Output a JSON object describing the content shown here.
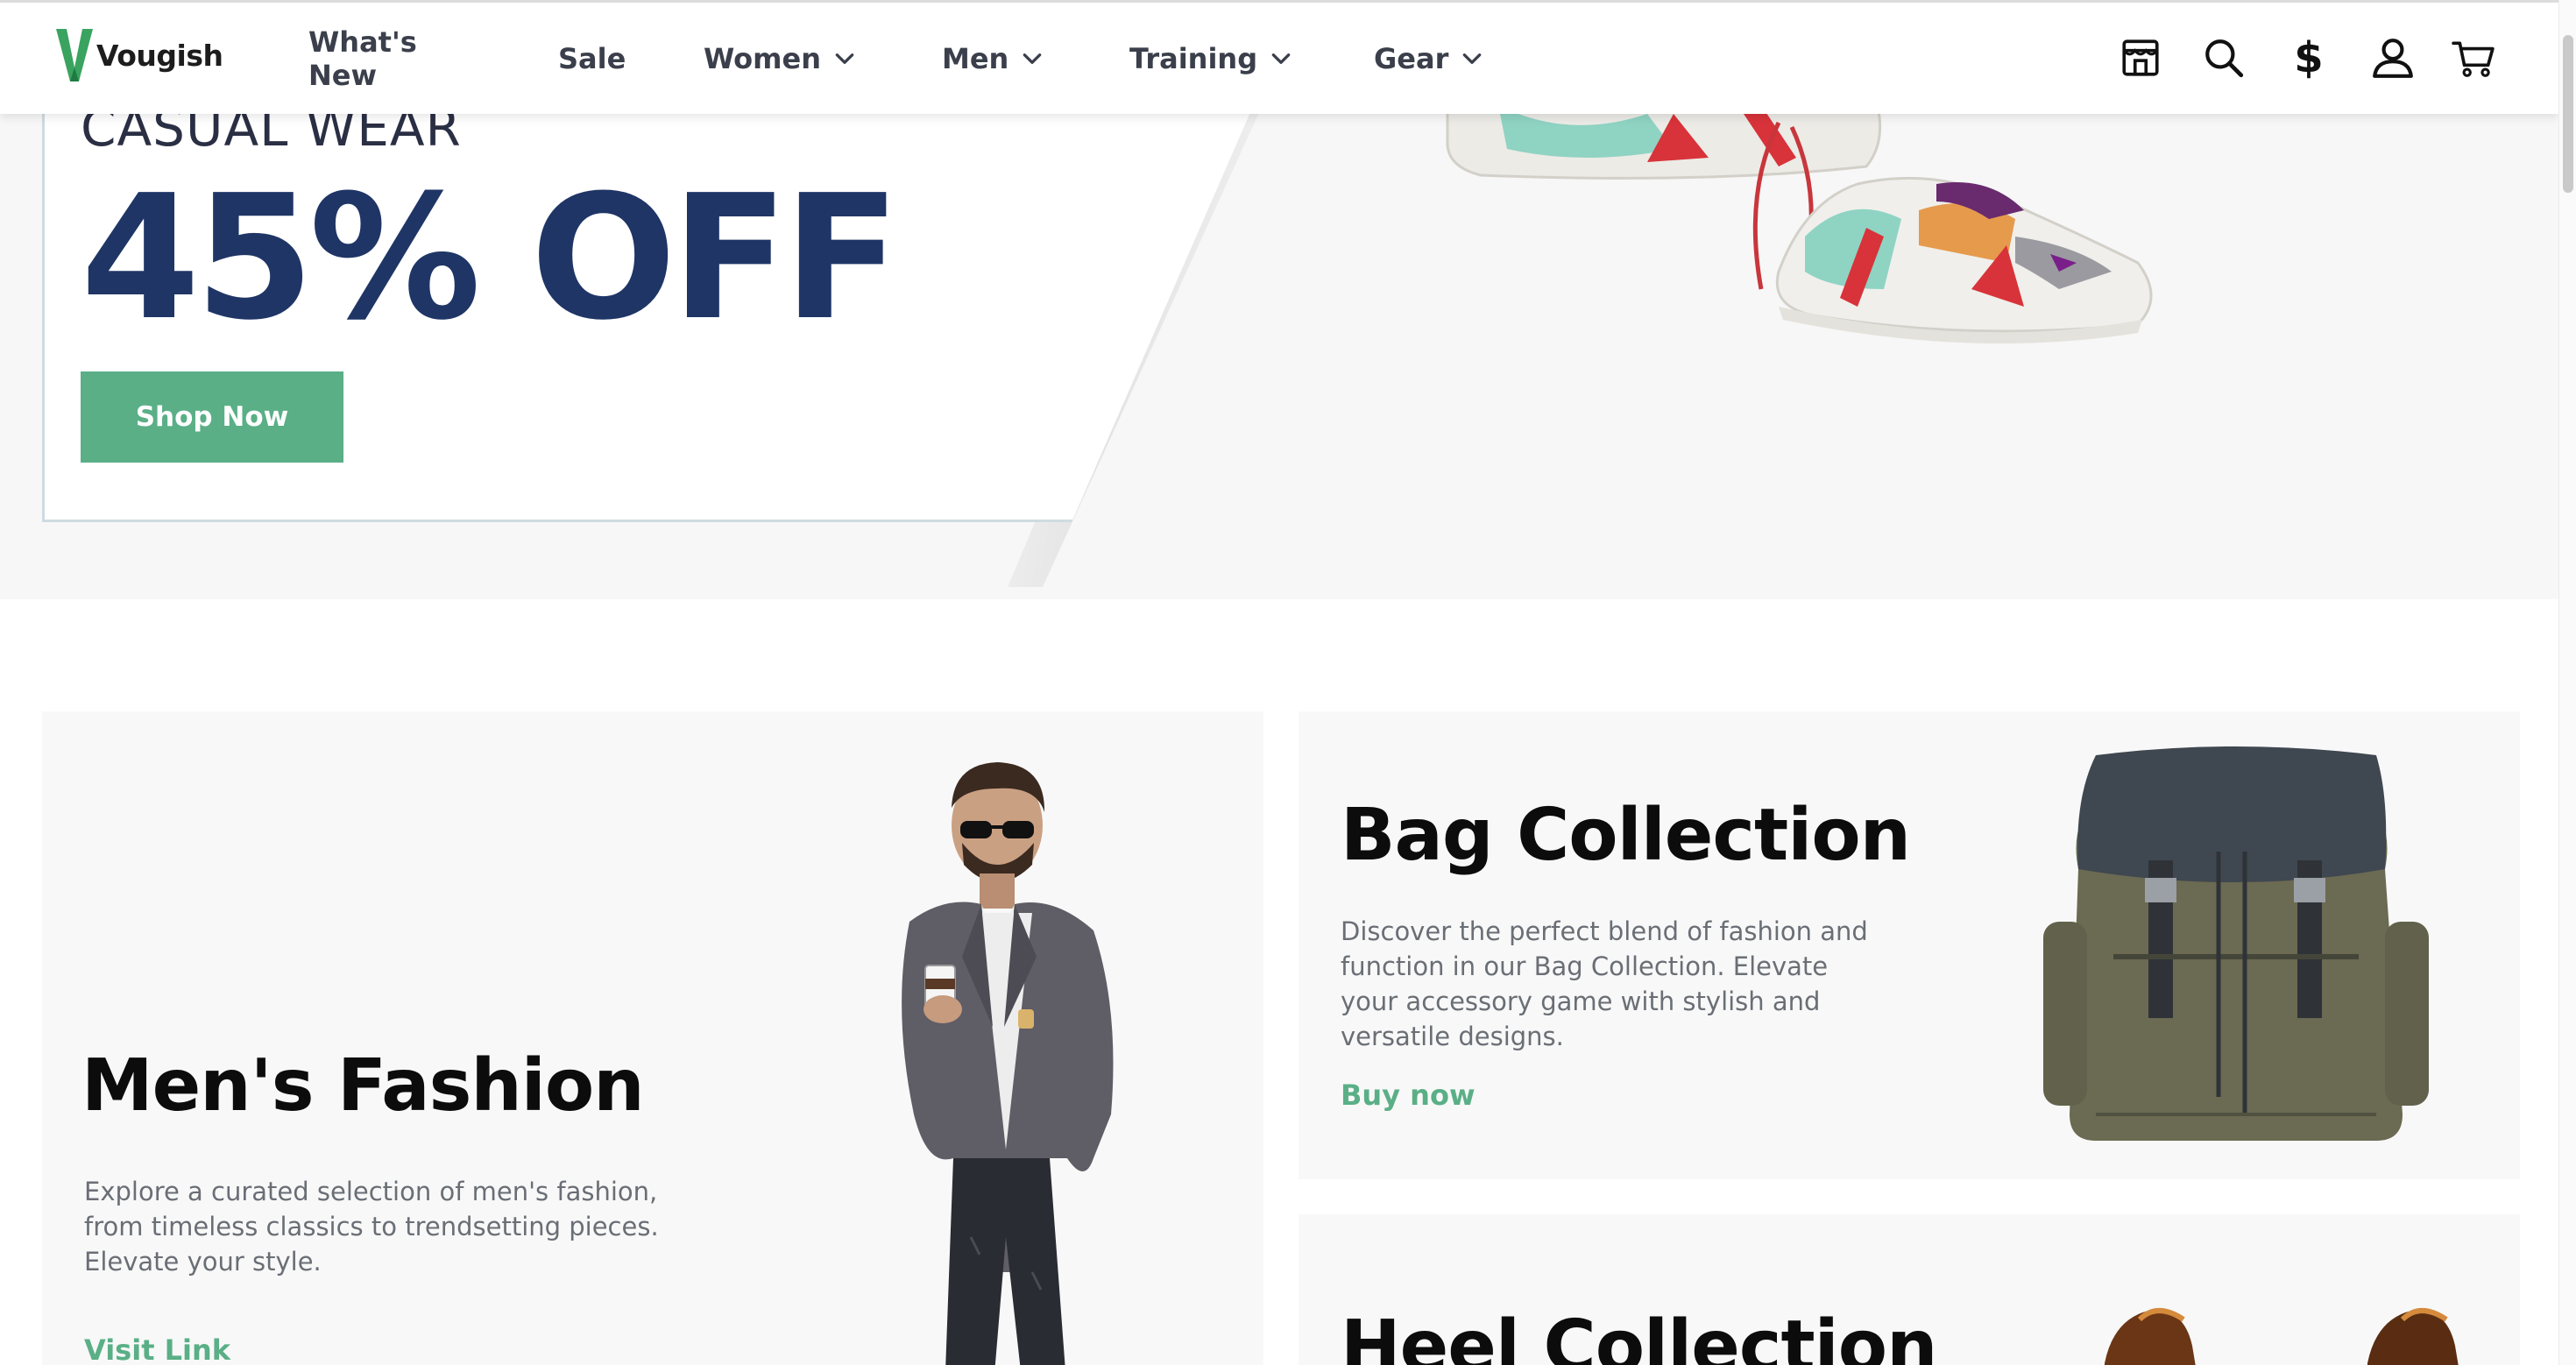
{
  "brand": {
    "name": "Vougish",
    "logo_color": "#3aa35f"
  },
  "nav": {
    "items": [
      {
        "label": "What's New",
        "has_dropdown": false
      },
      {
        "label": "Sale",
        "has_dropdown": false
      },
      {
        "label": "Women",
        "has_dropdown": true
      },
      {
        "label": "Men",
        "has_dropdown": true
      },
      {
        "label": "Training",
        "has_dropdown": true
      },
      {
        "label": "Gear",
        "has_dropdown": true
      }
    ],
    "icons": [
      "store-icon",
      "search-icon",
      "currency-icon",
      "account-icon",
      "cart-icon"
    ],
    "currency_symbol": "$"
  },
  "hero": {
    "kicker": "CASUAL WEAR",
    "headline": "45% OFF",
    "cta_label": "Shop Now",
    "colors": {
      "headline": "#1f3566",
      "cta": "#5aaf86"
    }
  },
  "promos": {
    "mens": {
      "title": "Men's Fashion",
      "description": "Explore a curated selection of men's fashion, from timeless classics to trendsetting pieces. Elevate your style.",
      "link_label": "Visit Link"
    },
    "bag": {
      "title": "Bag Collection",
      "description": "Discover the perfect blend of fashion and function in our Bag Collection. Elevate your accessory game with stylish and versatile designs.",
      "link_label": "Buy now"
    },
    "heel": {
      "title": "Heel Collection"
    },
    "link_color": "#5aaf86"
  }
}
